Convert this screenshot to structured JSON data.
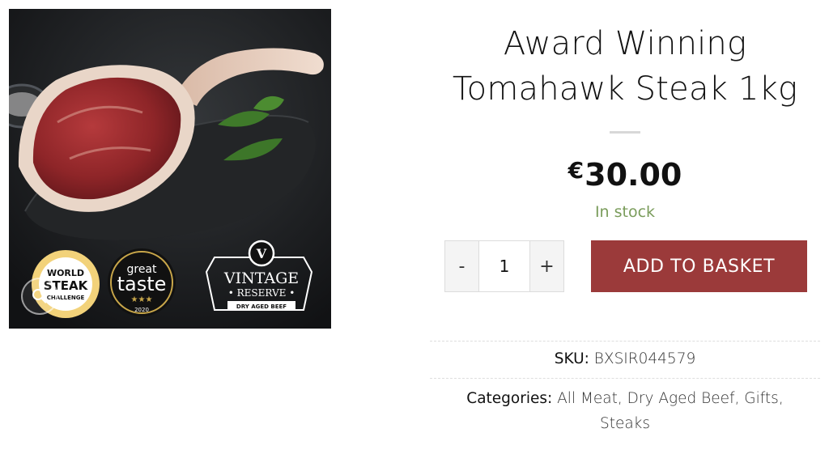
{
  "product": {
    "title_line1": "Award Winning",
    "title_line2": "Tomahawk Steak 1kg",
    "price_currency": "€",
    "price_amount": "30.00",
    "stock_status": "In stock",
    "quantity": "1",
    "qty_minus": "-",
    "qty_plus": "+",
    "add_to_basket_label": "ADD TO BASKET",
    "sku_label": "SKU:",
    "sku_value": "BXSIR044579",
    "categories_label": "Categories:",
    "categories": [
      "All Meat",
      "Dry Aged Beef",
      "Gifts",
      "Steaks"
    ]
  },
  "badges": {
    "world_steak": [
      "WORLD",
      "STEAK",
      "CHALLENGE"
    ],
    "great_taste": [
      "great",
      "taste",
      "★★★",
      "2020"
    ],
    "vintage_reserve": [
      "V",
      "VINTAGE",
      "• RESERVE •",
      "DRY AGED BEEF"
    ]
  },
  "colors": {
    "accent_button": "#9b3a3a",
    "stock_green": "#7a9c5b"
  },
  "icons": {
    "zoom": "magnifier-icon"
  }
}
